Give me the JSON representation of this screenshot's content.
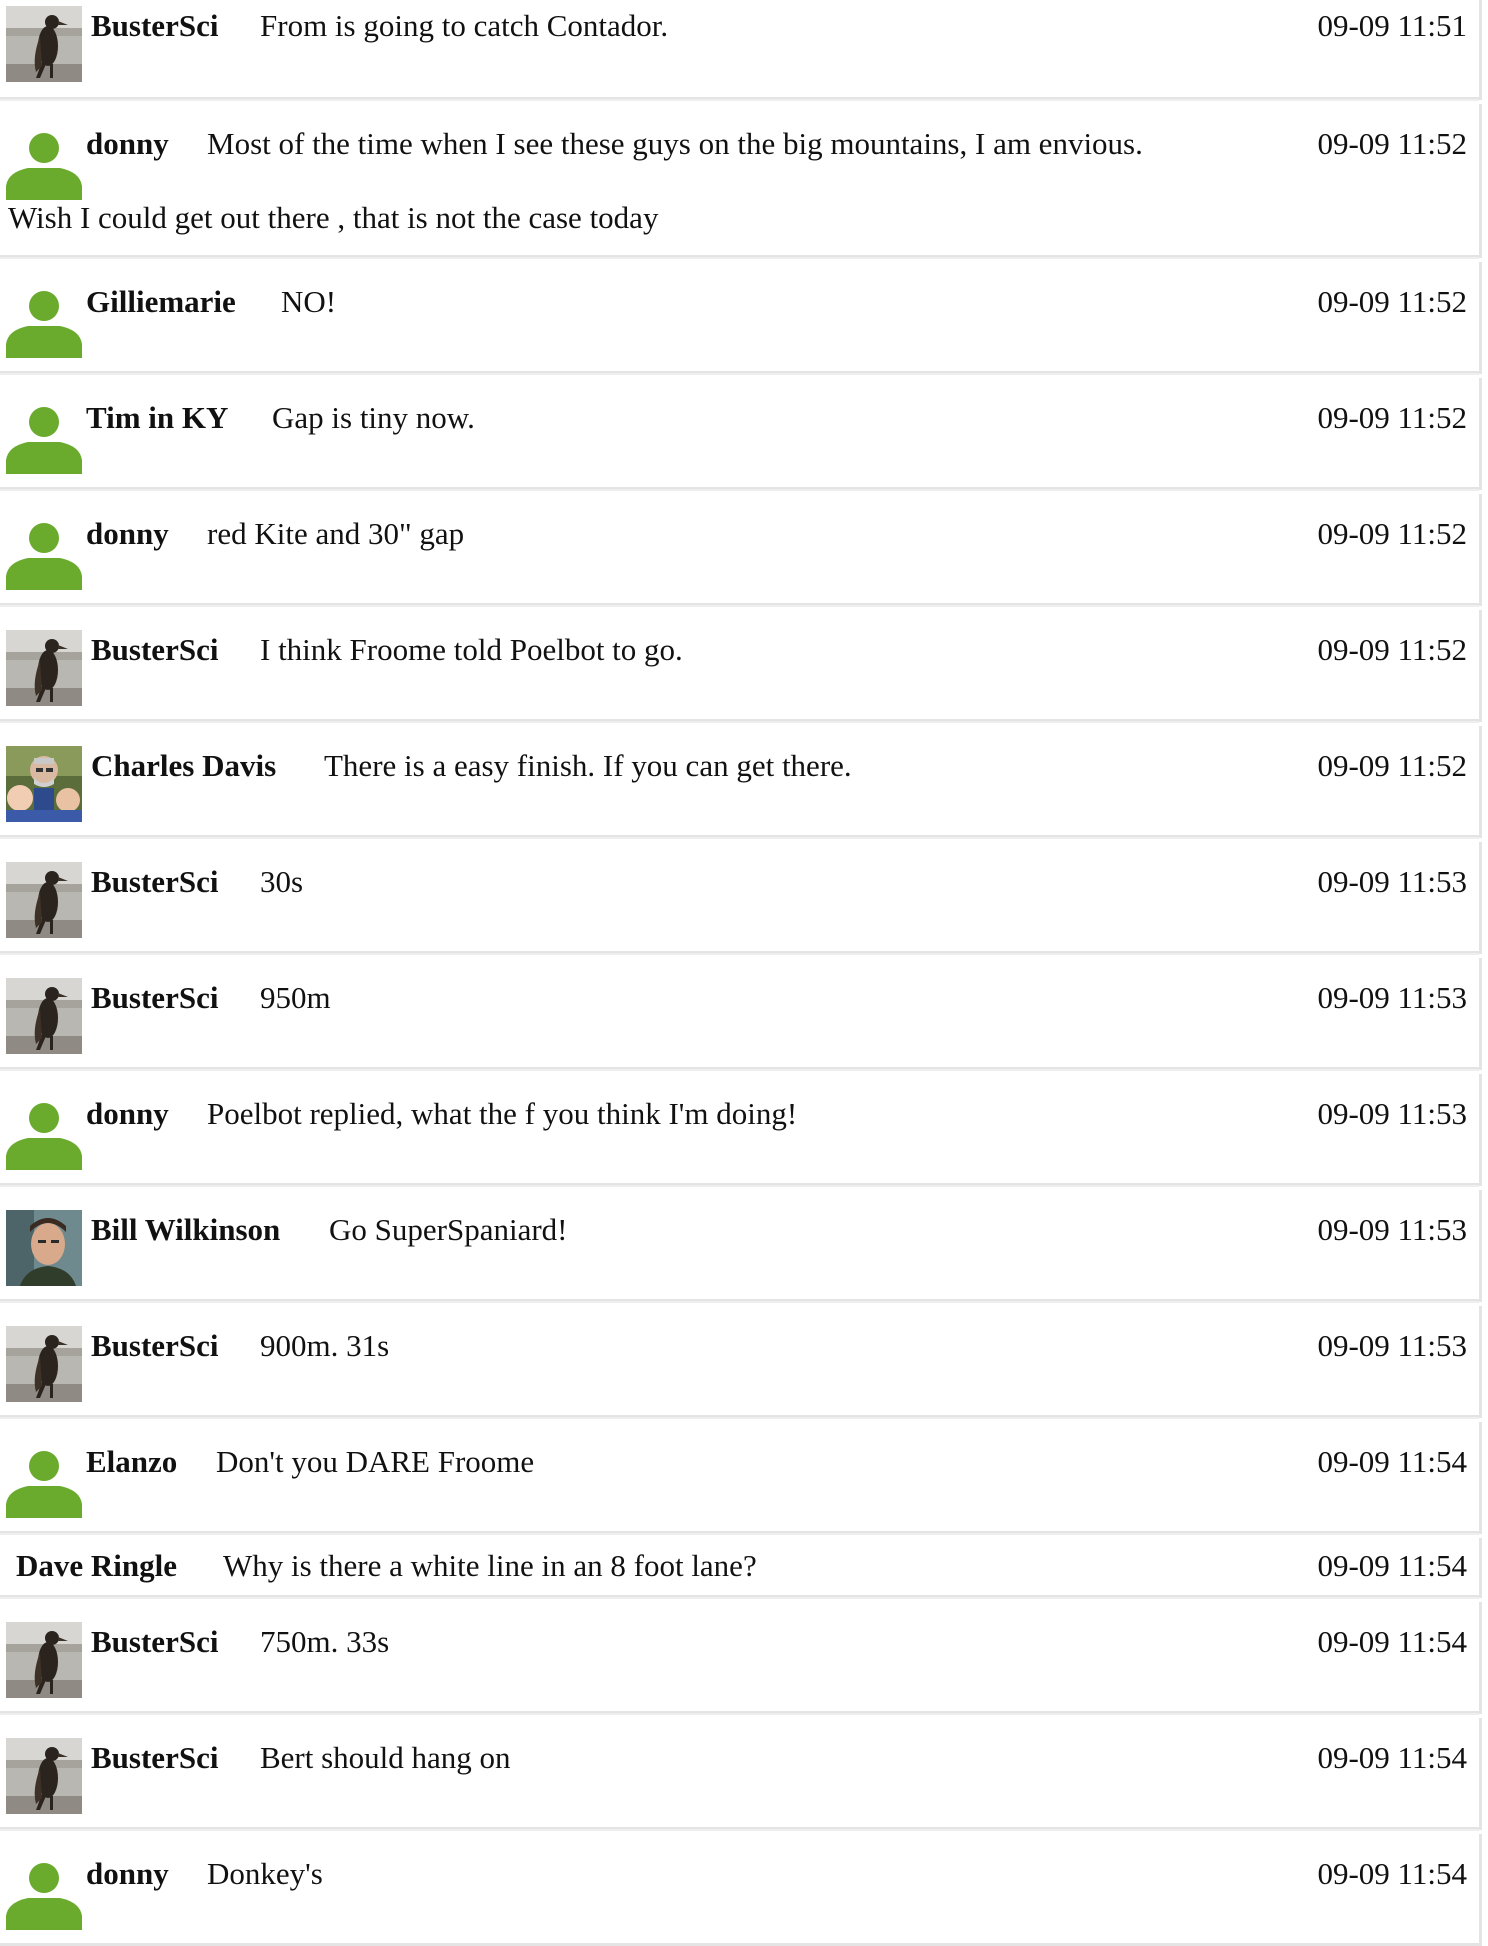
{
  "comments": [
    {
      "author": "BusterSci",
      "avatar": "bird-photo-icon",
      "message": "From is going to catch Contador.",
      "time": "09-09 11:51"
    },
    {
      "author": "donny",
      "avatar": "default-user-icon",
      "message": "Most of the time when I see these guys on the big mountains, I am envious.",
      "continuation": "Wish I could get out there , that is not the case today",
      "time": "09-09 11:52"
    },
    {
      "author": "Gilliemarie",
      "avatar": "default-user-icon",
      "message": "NO!",
      "time": "09-09 11:52"
    },
    {
      "author": "Tim in KY",
      "avatar": "default-user-icon",
      "message": "Gap is tiny now.",
      "time": "09-09 11:52"
    },
    {
      "author": "donny",
      "avatar": "default-user-icon",
      "message": "red Kite and 30\" gap",
      "time": "09-09 11:52"
    },
    {
      "author": "BusterSci",
      "avatar": "bird-photo-icon",
      "message": "I think Froome told Poelbot to go.",
      "time": "09-09 11:52"
    },
    {
      "author": "Charles Davis",
      "avatar": "family-photo-icon",
      "message": "There is a easy finish. If you can get there.",
      "time": "09-09 11:52"
    },
    {
      "author": "BusterSci",
      "avatar": "bird-photo-icon",
      "message": "30s",
      "time": "09-09 11:53"
    },
    {
      "author": "BusterSci",
      "avatar": "bird-photo-icon",
      "message": "950m",
      "time": "09-09 11:53"
    },
    {
      "author": "donny",
      "avatar": "default-user-icon",
      "message": "Poelbot replied, what the f you think I'm doing!",
      "time": "09-09 11:53"
    },
    {
      "author": "Bill Wilkinson",
      "avatar": "man-photo-icon",
      "message": "Go SuperSpaniard!",
      "time": "09-09 11:53"
    },
    {
      "author": "BusterSci",
      "avatar": "bird-photo-icon",
      "message": "900m. 31s",
      "time": "09-09 11:53"
    },
    {
      "author": "Elanzo",
      "avatar": "default-user-icon",
      "message": "Don't you DARE Froome",
      "time": "09-09 11:54"
    },
    {
      "author": "Dave Ringle",
      "avatar": "",
      "message": "Why is there a white line in an 8 foot lane?",
      "time": "09-09 11:54"
    },
    {
      "author": "BusterSci",
      "avatar": "bird-photo-icon",
      "message": "750m. 33s",
      "time": "09-09 11:54"
    },
    {
      "author": "BusterSci",
      "avatar": "bird-photo-icon",
      "message": "Bert should hang on",
      "time": "09-09 11:54"
    },
    {
      "author": "donny",
      "avatar": "default-user-icon",
      "message": "Donkey's",
      "time": "09-09 11:54"
    }
  ],
  "colors": {
    "default_avatar_green": "#6aab2e",
    "divider": "#e4e4e4"
  }
}
